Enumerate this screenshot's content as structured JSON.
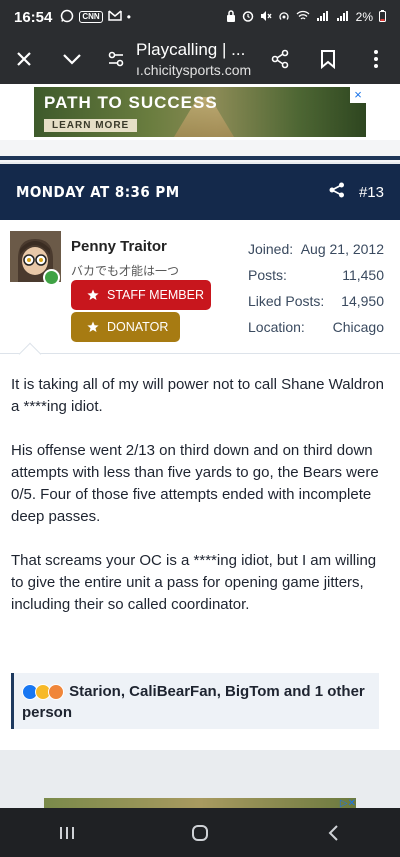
{
  "status_bar": {
    "time": "16:54",
    "cnn_label": "CNN",
    "battery": "2%"
  },
  "browser": {
    "title": "Playcalling | ...",
    "url": "ı.chicitysports.com"
  },
  "ad_top": {
    "headline": "PATH TO SUCCESS",
    "cta": "LEARN MORE",
    "close": "×"
  },
  "post": {
    "date": "MONDAY AT 8:36 PM",
    "number": "#13"
  },
  "user": {
    "name": "Penny Traitor",
    "title": "バカでも才能は一つ",
    "badges": {
      "staff": "STAFF MEMBER",
      "donator": "DONATOR"
    },
    "stats": [
      {
        "label": "Joined:",
        "value": "Aug 21, 2012"
      },
      {
        "label": "Posts:",
        "value": "11,450"
      },
      {
        "label": "Liked Posts:",
        "value": "14,950"
      },
      {
        "label": "Location:",
        "value": "Chicago"
      }
    ]
  },
  "message": {
    "paragraphs": [
      "It is taking all of my will power not to call Shane Waldron a ****ing idiot.",
      "His offense went 2/13 on third down and on third down attempts with less than five yards to go, the Bears were 0/5. Four of those five attempts ended with incomplete deep passes.",
      "That screams your OC is a ****ing idiot, but I am willing to give the entire unit a pass for opening game jitters, including their so called coordinator."
    ]
  },
  "reactions": {
    "text": "Starion, CaliBearFan, BigTom and 1 other person"
  },
  "colors": {
    "header_bg": "#14294b",
    "staff_badge": "#c8161d",
    "donator_badge": "#a77b12",
    "online": "#3fa244"
  }
}
